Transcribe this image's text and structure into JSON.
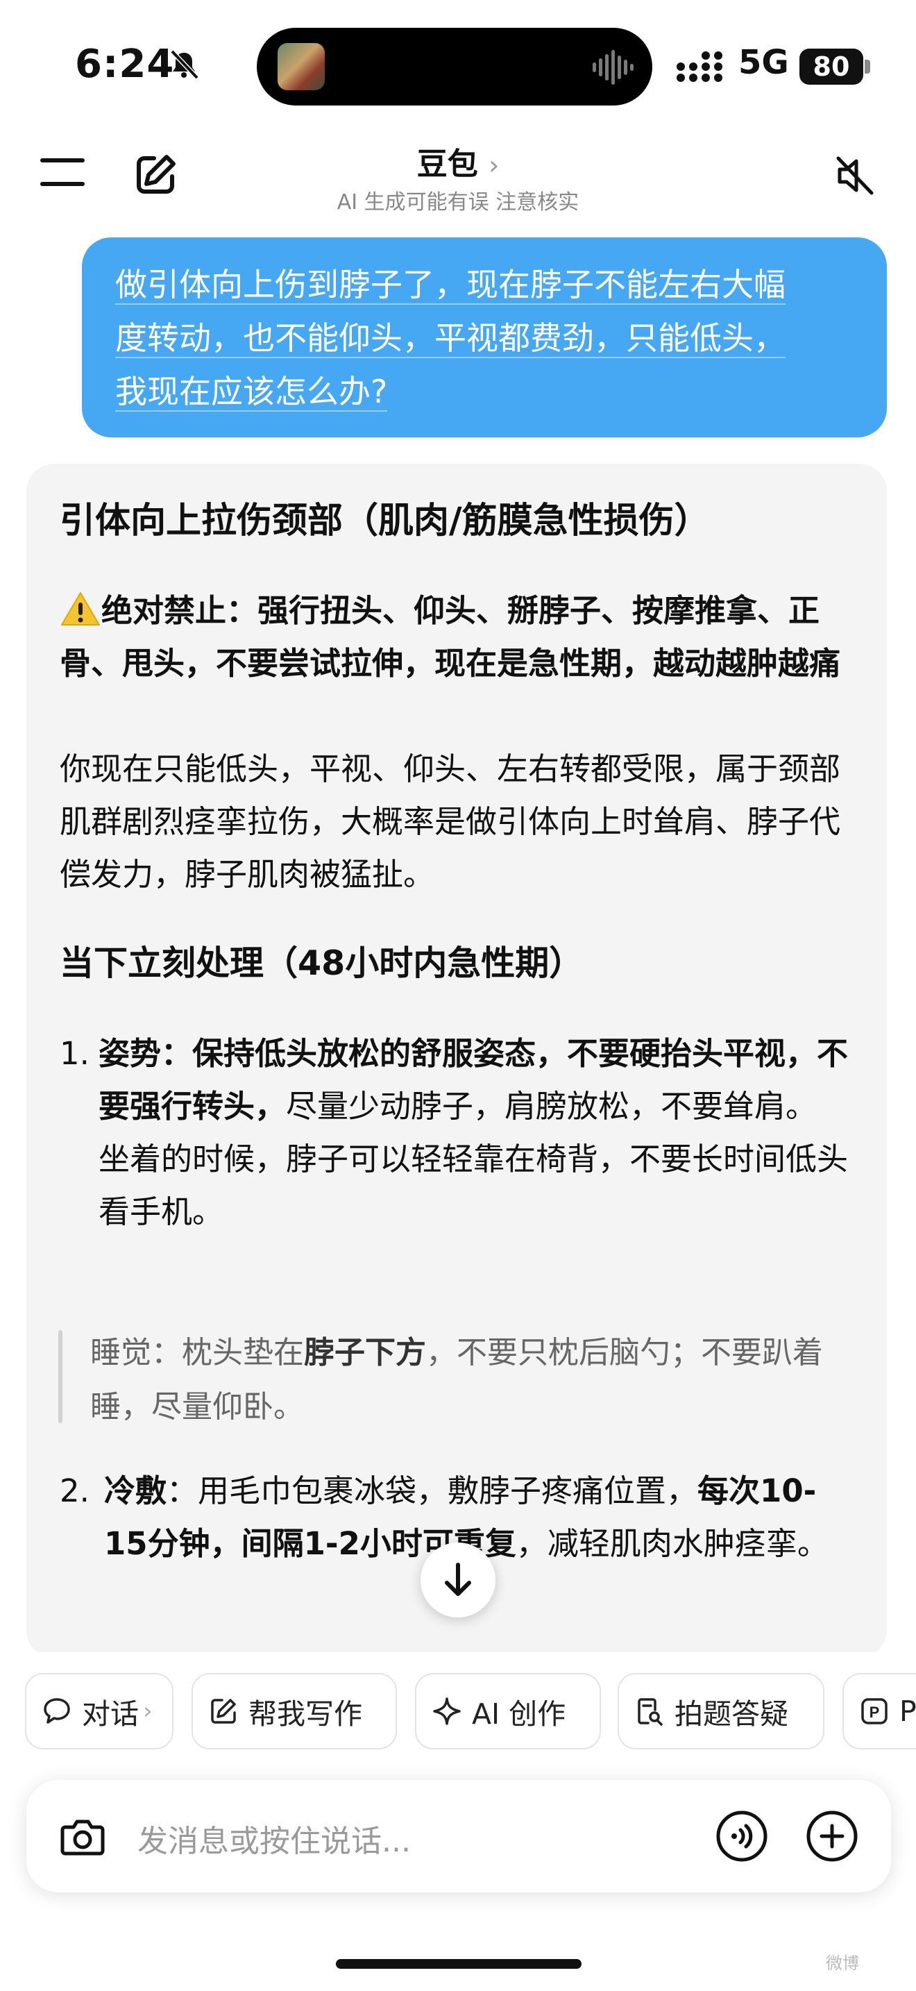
{
  "status_bar": {
    "time": "6:24",
    "network": "5G",
    "battery": "80",
    "icons": [
      "bell-slash-icon",
      "audio-wave-icon",
      "signal-icon"
    ]
  },
  "header": {
    "title": "豆包",
    "title_chevron": "›",
    "subtitle": "AI 生成可能有误 注意核实",
    "icons": [
      "menu-icon",
      "edit-icon",
      "speaker-muted-icon"
    ]
  },
  "user_message": {
    "line1": "做引体向上伤到脖子了，现在脖子不能左右大幅",
    "line2": "度转动，也不能仰头，平视都费劲，只能低头，",
    "line3": "我现在应该怎么办?"
  },
  "answer": {
    "heading": "引体向上拉伤颈部（肌肉/筋膜急性损伤）",
    "warning": "绝对禁止：强行扭头、仰头、掰脖子、按摩推拿、正骨、甩头，不要尝试拉伸，现在是急性期，越动越肿越痛",
    "paragraph": "你现在只能低头，平视、仰头、左右转都受限，属于颈部肌群剧烈痉挛拉伤，大概率是做引体向上时耸肩、脖子代偿发力，脖子肌肉被猛扯。",
    "section_heading": "当下立刻处理（48小时内急性期）",
    "item1_number": "1.",
    "item1_bold": "姿势：保持低头放松的舒服姿态，不要硬抬头平视，不要强行转头，",
    "item1_rest": "尽量少动脖子，肩膀放松，不要耸肩。",
    "item1_extra": "坐着的时候，脖子可以轻轻靠在椅背，不要长时间低头看手机。",
    "quote_a": "睡觉：枕头垫在",
    "quote_bold": "脖子下方",
    "quote_b": "，不要只枕后脑勺；不要趴着睡，尽量仰卧。",
    "item2_number": "2.",
    "item2_bold1": "冷敷",
    "item2_text": "：用毛巾包裹冰袋，敷脖子疼痛位置，",
    "item2_bold2": "每次10-15分钟，间隔1-2小时可重复",
    "item2_tail": "，减轻肌肉水肿痉挛。"
  },
  "chips": [
    {
      "label": "对话",
      "icon": "chat-bubble-icon",
      "chevron": "›"
    },
    {
      "label": "帮我写作",
      "icon": "pencil-square-icon"
    },
    {
      "label": "AI 创作",
      "icon": "sparkle-icon"
    },
    {
      "label": "拍题答疑",
      "icon": "document-search-icon"
    },
    {
      "label": "P",
      "icon": "p-box-icon"
    }
  ],
  "input": {
    "placeholder": "发消息或按住说话..."
  },
  "watermark": "微博"
}
